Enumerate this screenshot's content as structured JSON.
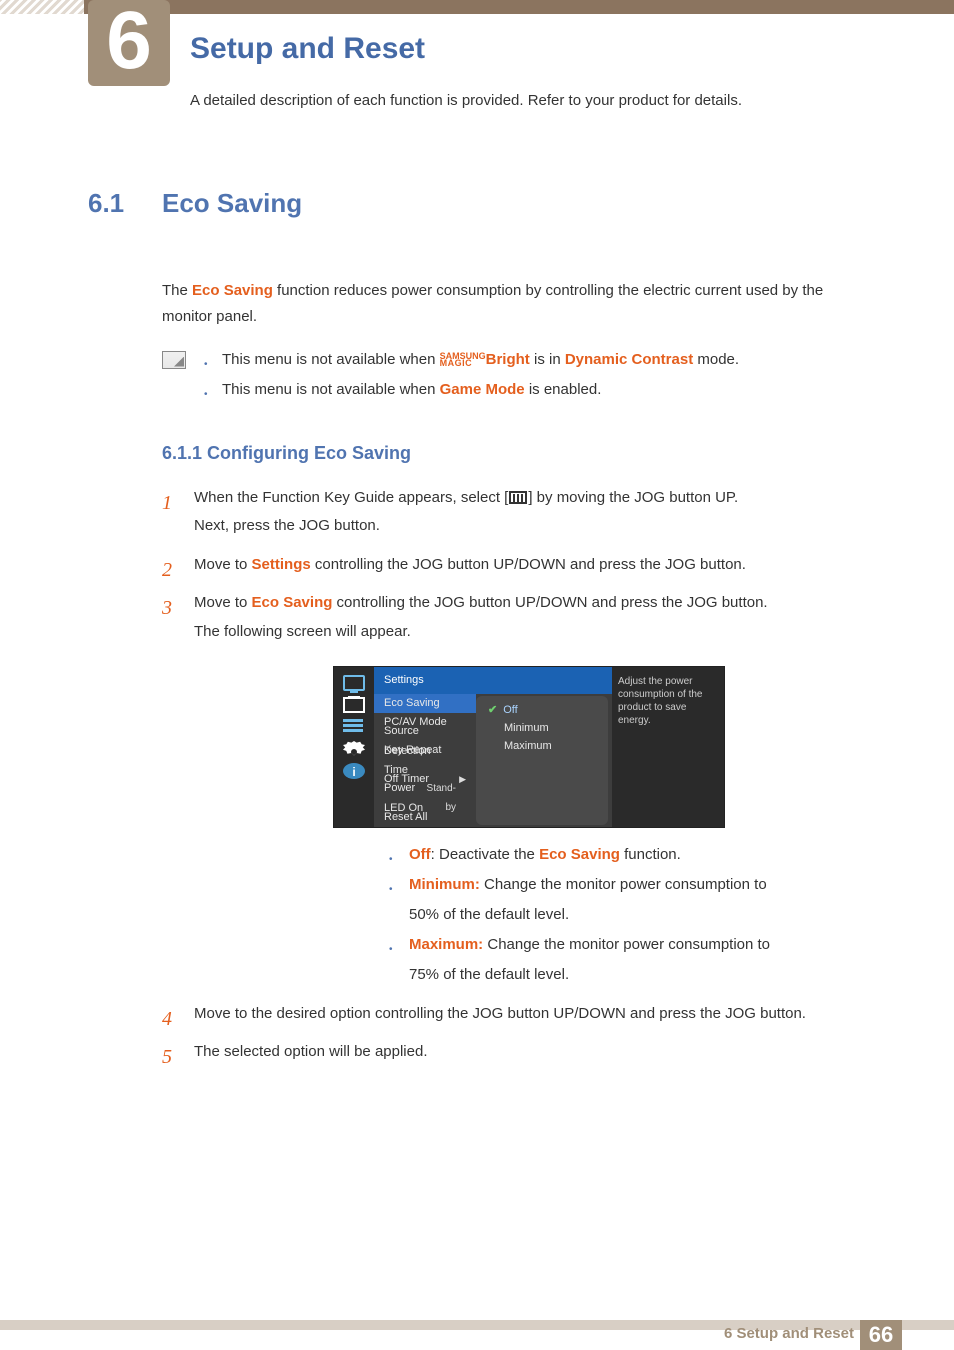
{
  "chapter": {
    "num": "6",
    "title": "Setup and Reset",
    "sub": "A detailed description of each function is provided. Refer to your product for details."
  },
  "sec": {
    "num": "6.1",
    "title": "Eco Saving"
  },
  "intro": {
    "pre": "The ",
    "hl": "Eco Saving",
    "post": " function reduces power consumption by controlling the electric current used by the monitor panel."
  },
  "notes": {
    "n1": {
      "pre": "This menu is not available when ",
      "sm_top": "SAMSUNG",
      "sm_bot": "MAGIC",
      "bright": "Bright",
      "mid": " is in ",
      "hl": "Dynamic Contrast",
      "post": " mode."
    },
    "n2": {
      "pre": "This menu is not available when ",
      "hl": "Game Mode",
      "post": " is enabled."
    }
  },
  "subhead": "6.1.1   Configuring Eco Saving",
  "steps": {
    "s1a": "When the Function Key Guide appears, select [",
    "s1b": "] by moving the JOG button UP.",
    "s1c": "Next, press the JOG button.",
    "s2a": "Move to ",
    "s2hl": "Settings",
    "s2b": " controlling the JOG button UP/DOWN and press the JOG button.",
    "s3a": "Move to ",
    "s3hl": "Eco Saving",
    "s3b": " controlling the JOG button UP/DOWN and press the JOG button.",
    "s3c": "The following screen will appear.",
    "s4": "Move to the desired option controlling the JOG button UP/DOWN and press the JOG button.",
    "s5": "The selected option will be applied."
  },
  "osd": {
    "header": "Settings",
    "items": [
      "Eco Saving",
      "PC/AV Mode",
      "Source Detection",
      "Key Repeat Time",
      "Off Timer",
      "Power LED On",
      "Reset All"
    ],
    "sub": [
      "Off",
      "Minimum",
      "Maximum"
    ],
    "standby": "Stand-by",
    "help": "Adjust the power consumption of the product to save energy.",
    "info_glyph": "i"
  },
  "opts": {
    "off_hl": "Off",
    "off_txt": ": Deactivate the ",
    "off_hl2": "Eco Saving",
    "off_post": " function.",
    "min_hl": "Minimum:",
    "min_txt": " Change the monitor power consumption to 50% of the default level.",
    "max_hl": "Maximum:",
    "max_txt": " Change the monitor power consumption to 75% of the default level."
  },
  "footer": {
    "label": "6 Setup and Reset",
    "page": "66"
  }
}
